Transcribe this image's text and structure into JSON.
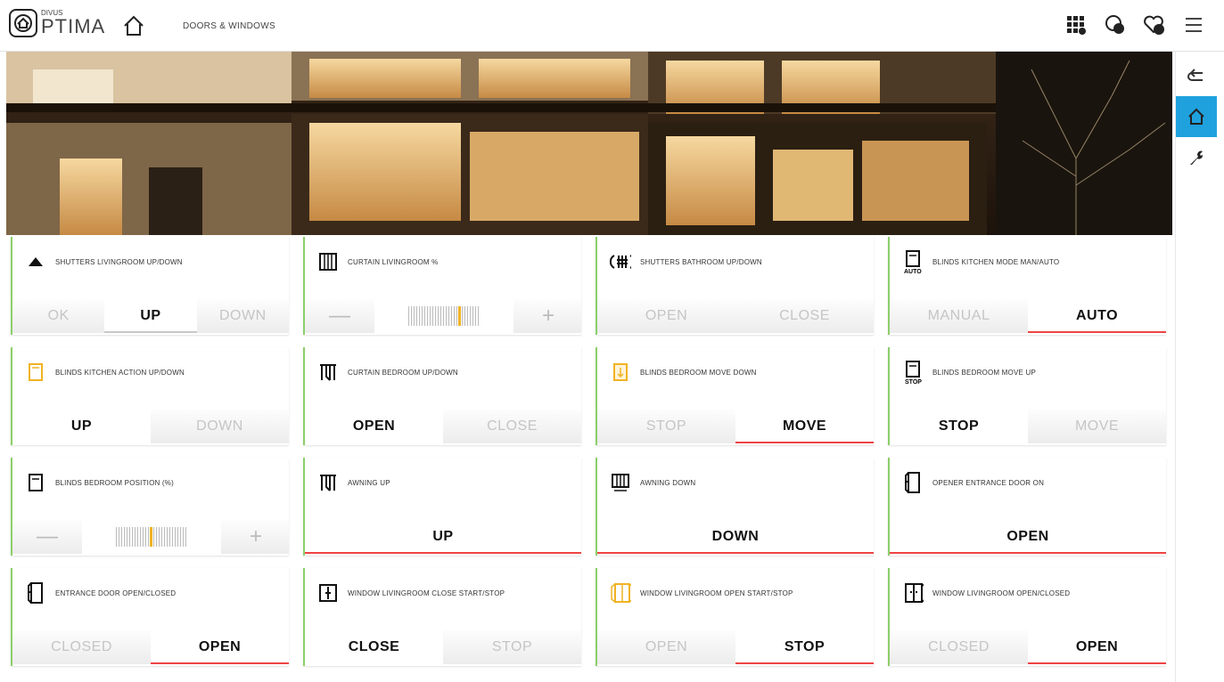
{
  "app": {
    "brand_small": "DIVUS",
    "brand_big": "PTIMA",
    "breadcrumb": "DOORS & WINDOWS"
  },
  "top_icons": [
    "scenes-grid-icon",
    "notification-icon",
    "favorites-icon",
    "menu-icon"
  ],
  "right_nav": [
    "back-icon",
    "home-icon",
    "wrench-icon"
  ],
  "colors": {
    "accent": "#1fa1de",
    "active_line": "#e44444",
    "ok_border": "#8ccf6a",
    "amber": "#f0b323"
  },
  "cards": [
    {
      "title": "SHUTTERS LIVINGROOM UP/DOWN",
      "icon": "triangle-up-icon",
      "buttons": [
        "OK",
        "UP",
        "DOWN"
      ]
    },
    {
      "title": "CURTAIN LIVINGROOM %",
      "icon": "curtain-icon",
      "slider": {
        "minus": "—",
        "plus": "+",
        "level": 0.72
      }
    },
    {
      "title": "SHUTTERS BATHROOM UP/DOWN",
      "icon": "shutter-wind-icon",
      "buttons": [
        "OPEN",
        "CLOSE"
      ]
    },
    {
      "title": "BLINDS KITCHEN MODE MAN/AUTO",
      "icon": "blind-auto-icon",
      "icon_label": "AUTO",
      "buttons": [
        "MANUAL",
        "AUTO"
      ]
    },
    {
      "title": "BLINDS KITCHEN ACTION UP/DOWN",
      "icon": "blind-icon",
      "buttons": [
        "UP",
        "DOWN"
      ]
    },
    {
      "title": "CURTAIN BEDROOM UP/DOWN",
      "icon": "curtain-bedroom-icon",
      "buttons": [
        "OPEN",
        "CLOSE"
      ]
    },
    {
      "title": "BLINDS BEDROOM MOVE DOWN",
      "icon": "blind-move-icon",
      "buttons": [
        "STOP",
        "MOVE"
      ]
    },
    {
      "title": "BLINDS BEDROOM MOVE UP",
      "icon": "blind-stop-icon",
      "icon_label": "STOP",
      "buttons": [
        "STOP",
        "MOVE"
      ]
    },
    {
      "title": "BLINDS BEDROOM POSITION (%)",
      "icon": "blind-position-icon",
      "slider": {
        "minus": "—",
        "plus": "+",
        "level": 0.5
      }
    },
    {
      "title": "AWNING UP",
      "icon": "awning-icon",
      "buttons": [
        "UP"
      ]
    },
    {
      "title": "AWNING DOWN",
      "icon": "awning-down-icon",
      "buttons": [
        "DOWN"
      ]
    },
    {
      "title": "OPENER ENTRANCE DOOR ON",
      "icon": "door-icon",
      "buttons": [
        "OPEN"
      ]
    },
    {
      "title": "ENTRANCE DOOR OPEN/CLOSED",
      "icon": "door-icon",
      "buttons": [
        "CLOSED",
        "OPEN"
      ]
    },
    {
      "title": "WINDOW LIVINGROOM CLOSE START/STOP",
      "icon": "window-icon",
      "buttons": [
        "CLOSE",
        "STOP"
      ]
    },
    {
      "title": "WINDOW LIVINGROOM OPEN START/STOP",
      "icon": "window-open-icon",
      "buttons": [
        "OPEN",
        "STOP"
      ]
    },
    {
      "title": "WINDOW LIVINGROOM OPEN/CLOSED",
      "icon": "window-double-icon",
      "buttons": [
        "CLOSED",
        "OPEN"
      ]
    }
  ]
}
